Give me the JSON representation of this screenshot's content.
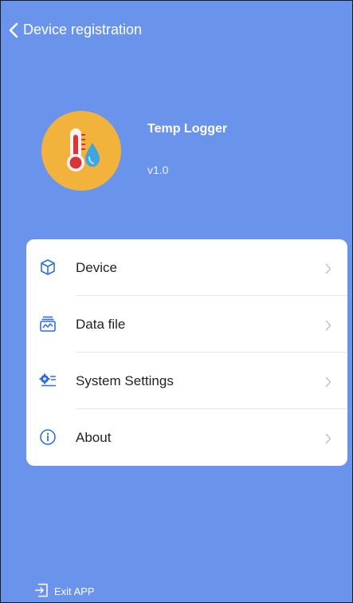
{
  "header": {
    "back_label": "Device registration",
    "back_icon": "chevron-left-icon"
  },
  "app": {
    "name": "Temp Logger",
    "version": "v1.0",
    "logo_icon": "thermometer-droplet-icon"
  },
  "menu": {
    "items": [
      {
        "label": "Device",
        "icon": "cube-icon"
      },
      {
        "label": "Data file",
        "icon": "data-file-icon"
      },
      {
        "label": "System Settings",
        "icon": "settings-gear-icon"
      },
      {
        "label": "About",
        "icon": "info-icon"
      }
    ]
  },
  "footer": {
    "exit_label": "Exit APP",
    "exit_icon": "exit-icon"
  },
  "colors": {
    "background": "#6a93ec",
    "accent": "#2f6fe0",
    "logo_bg": "#f2b33c",
    "card": "#ffffff"
  }
}
